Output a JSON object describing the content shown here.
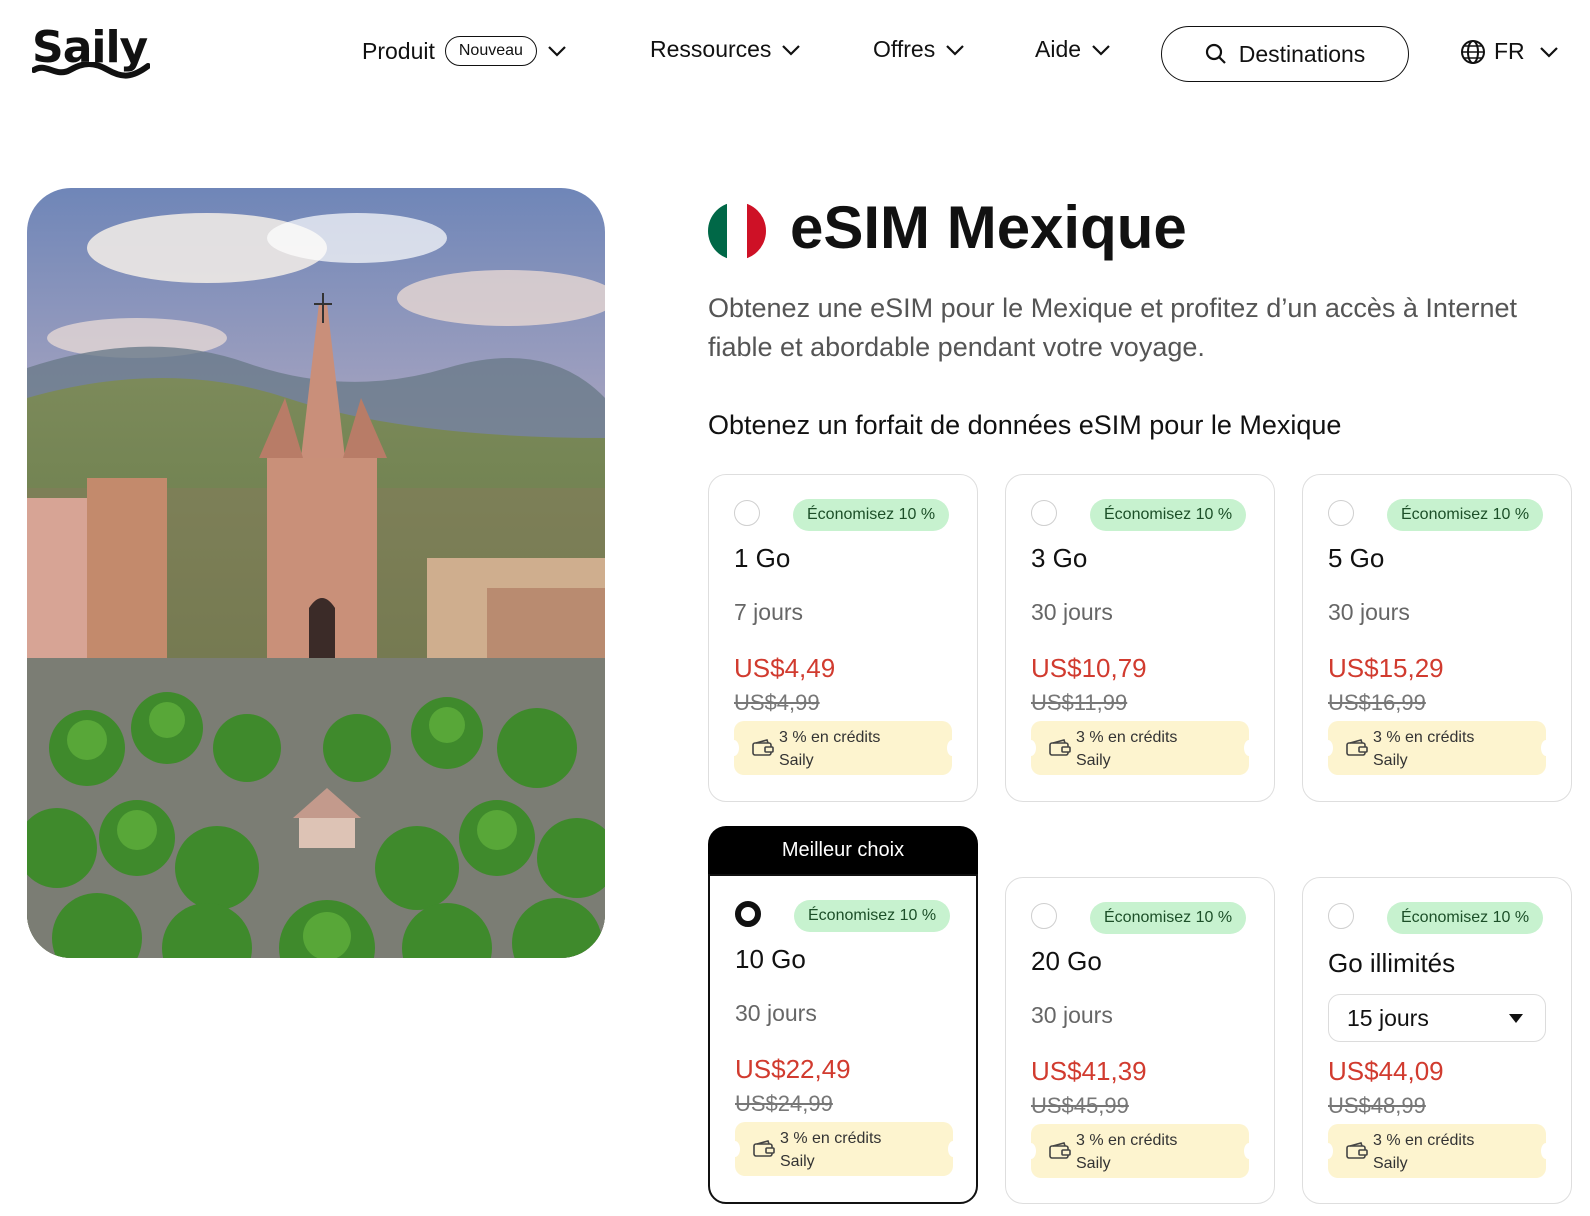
{
  "brand": {
    "logo_text": "Saily"
  },
  "nav": {
    "product": "Produit",
    "new_badge": "Nouveau",
    "resources": "Ressources",
    "offers": "Offres",
    "help": "Aide",
    "search_label": "Destinations",
    "language": "FR"
  },
  "hero": {
    "title": "eSIM Mexique",
    "description": "Obtenez une eSIM pour le Mexique et profitez d’un accès à Internet fiable et abordable pendant votre voyage.",
    "subtitle": "Obtenez un forfait de données eSIM pour le Mexique",
    "flag_colors": [
      "#006847",
      "#ffffff",
      "#ce1126"
    ]
  },
  "best_choice_label": "Meilleur choix",
  "plans": [
    {
      "save": "Économisez 10 %",
      "data": "1 Go",
      "days": "7 jours",
      "price": "US$4,49",
      "old_price": "US$4,99",
      "credit_line1": "3 % en crédits",
      "credit_line2": "Saily",
      "selected": false
    },
    {
      "save": "Économisez 10 %",
      "data": "3 Go",
      "days": "30 jours",
      "price": "US$10,79",
      "old_price": "US$11,99",
      "credit_line1": "3 % en crédits",
      "credit_line2": "Saily",
      "selected": false
    },
    {
      "save": "Économisez 10 %",
      "data": "5 Go",
      "days": "30 jours",
      "price": "US$15,29",
      "old_price": "US$16,99",
      "credit_line1": "3 % en crédits",
      "credit_line2": "Saily",
      "selected": false
    },
    {
      "save": "Économisez 10 %",
      "data": "10 Go",
      "days": "30 jours",
      "price": "US$22,49",
      "old_price": "US$24,99",
      "credit_line1": "3 % en crédits",
      "credit_line2": "Saily",
      "selected": true
    },
    {
      "save": "Économisez 10 %",
      "data": "20 Go",
      "days": "30 jours",
      "price": "US$41,39",
      "old_price": "US$45,99",
      "credit_line1": "3 % en crédits",
      "credit_line2": "Saily",
      "selected": false
    },
    {
      "save": "Économisez 10 %",
      "data": "Go illimités",
      "days_select": "15 jours",
      "price": "US$44,09",
      "old_price": "US$48,99",
      "credit_line1": "3 % en crédits",
      "credit_line2": "Saily",
      "selected": false
    }
  ],
  "colors": {
    "price": "#d13b2f",
    "save_badge_bg": "#c7f2cf",
    "credit_bg": "#fdf4cf"
  }
}
